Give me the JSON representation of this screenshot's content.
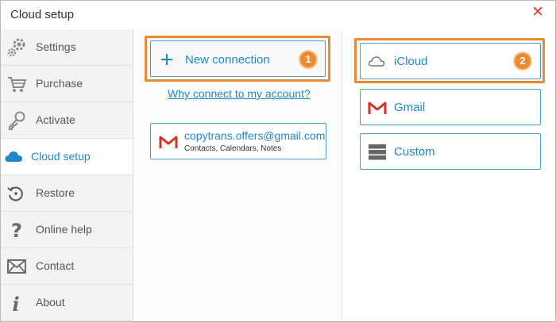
{
  "window": {
    "title": "Cloud setup",
    "close_glyph": "✕"
  },
  "sidebar": {
    "items": [
      {
        "label": "Settings",
        "icon": "gear-icon"
      },
      {
        "label": "Purchase",
        "icon": "cart-icon"
      },
      {
        "label": "Activate",
        "icon": "key-icon"
      },
      {
        "label": "Cloud setup",
        "icon": "cloud-icon",
        "active": true
      },
      {
        "label": "Restore",
        "icon": "restore-icon"
      },
      {
        "label": "Online help",
        "icon": "question-icon"
      },
      {
        "label": "Contact",
        "icon": "mail-icon"
      },
      {
        "label": "About",
        "icon": "info-icon"
      }
    ]
  },
  "middle": {
    "new_connection_label": "New connection",
    "new_connection_badge": "1",
    "why_link": "Why connect to my account?",
    "account": {
      "email": "copytrans.offers@gmail.com",
      "services": "Contacts, Calendars, Notes"
    }
  },
  "right": {
    "providers": [
      {
        "label": "iCloud",
        "icon": "cloud-outline-icon"
      },
      {
        "label": "Gmail",
        "icon": "gmail-icon"
      },
      {
        "label": "Custom",
        "icon": "server-icon"
      }
    ],
    "icloud_badge": "2"
  },
  "colors": {
    "accent": "#1e88c9",
    "highlight": "#e98b33",
    "close": "#e03c31"
  }
}
